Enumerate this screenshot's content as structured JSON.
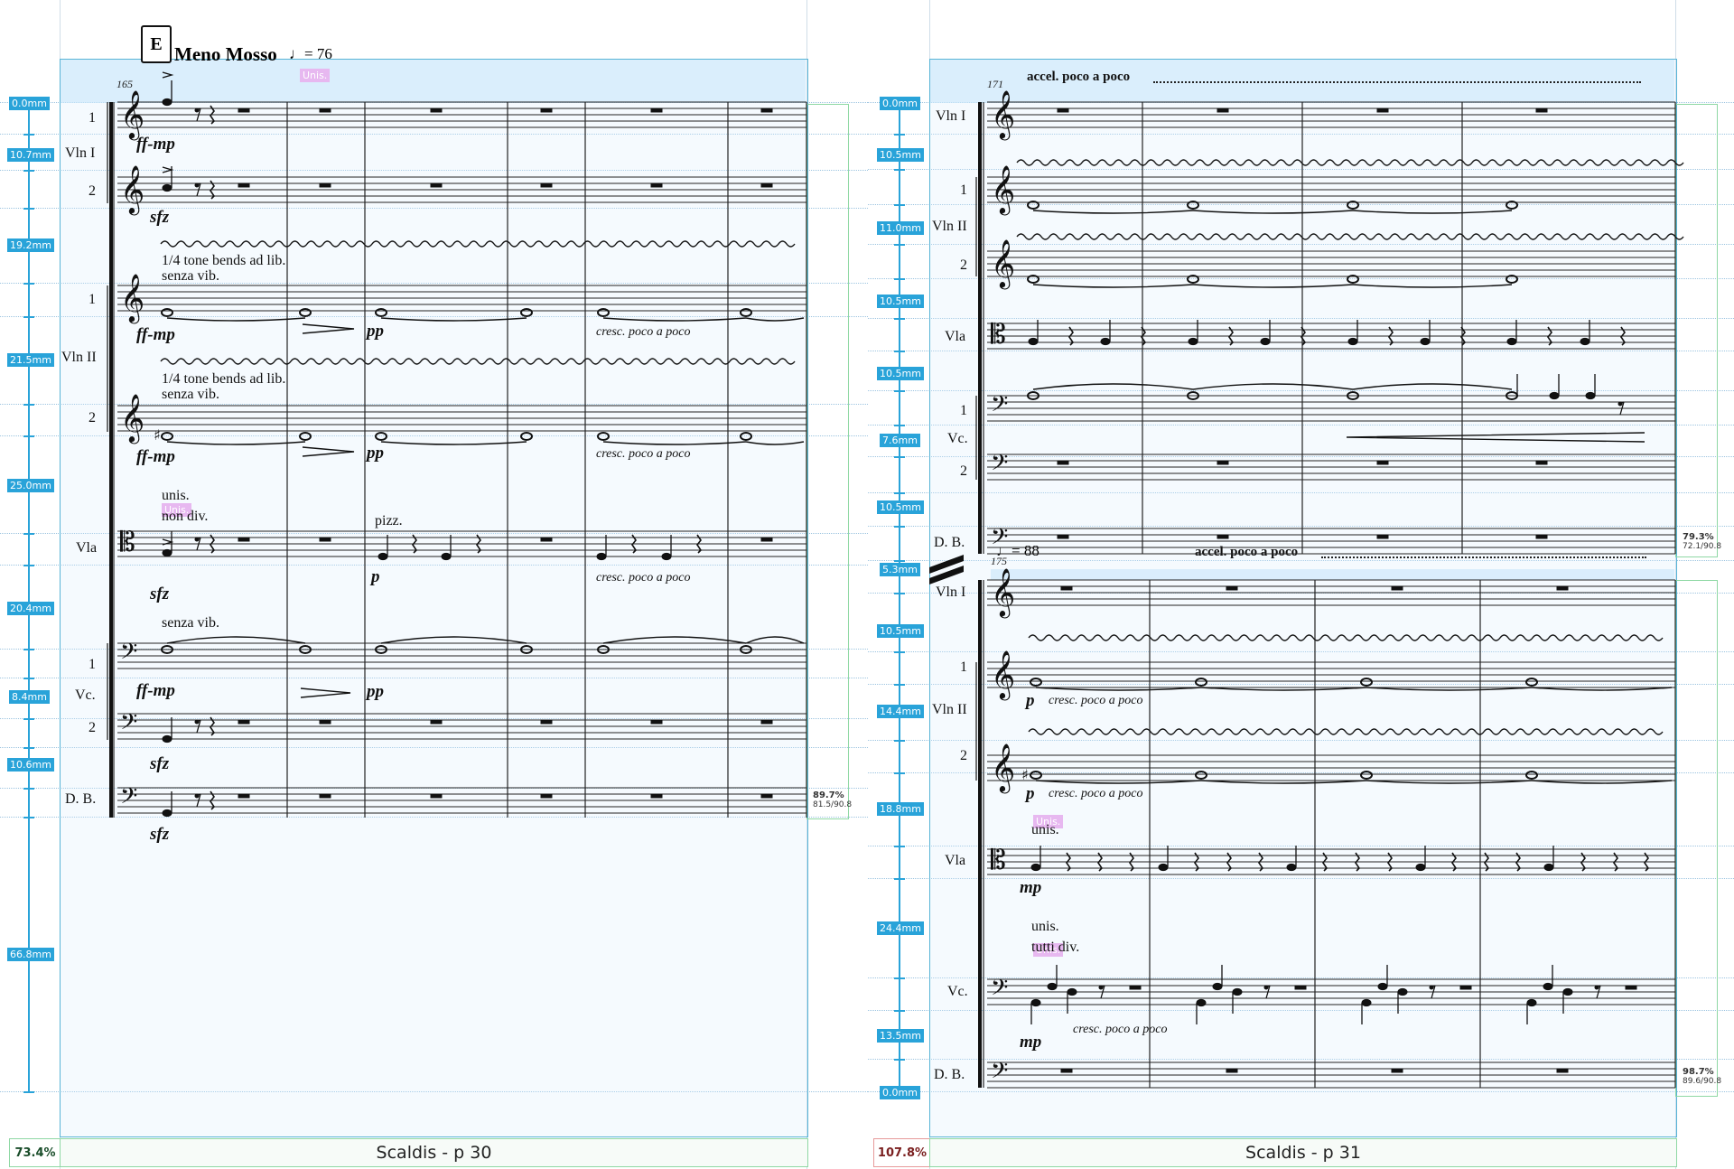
{
  "pages": {
    "left": {
      "footer": "Scaldis - p 30",
      "fill_pct": "73.4%",
      "system_fill_pct": "89.7%",
      "system_fill_ratio": "81.5/90.8",
      "rehearsal_mark": "E",
      "tempo_text": "Meno Mosso",
      "tempo_value": "= 76",
      "measure_number": "165",
      "tags": [
        "Unis.",
        "Unis."
      ],
      "spacing": [
        "0.0mm",
        "10.7mm",
        "19.2mm",
        "21.5mm",
        "25.0mm",
        "20.4mm",
        "8.4mm",
        "10.6mm",
        "66.8mm"
      ],
      "staff_labels": {
        "vln1_1": "1",
        "vln1": "Vln I",
        "vln1_2": "2",
        "vln2_1": "1",
        "vln2": "Vln II",
        "vln2_2": "2",
        "vla": "Vla",
        "vc1": "1",
        "vc": "Vc.",
        "vc2": "2",
        "db": "D. B."
      },
      "texts": {
        "bends1": "1/4 tone bends ad lib.",
        "senza1": "senza vib.",
        "bends2": "1/4 tone bends ad lib.",
        "senza2": "senza vib.",
        "unis": "unis.",
        "nondiv": "non div.",
        "pizz": "pizz.",
        "senza3": "senza vib.",
        "cresc1": "cresc. poco a poco",
        "cresc2": "cresc. poco a poco",
        "cresc3": "cresc. poco a poco"
      },
      "dynamics": {
        "d1": "ff-mp",
        "d2": "sfz",
        "d3": "ff-mp",
        "d4": "pp",
        "d5": "ff-mp",
        "d6": "pp",
        "d7": "sfz",
        "d8": "p",
        "d9": "ff-mp",
        "d10": "pp",
        "d11": "sfz",
        "d12": "sfz"
      }
    },
    "right": {
      "footer": "Scaldis - p 31",
      "fill_pct": "107.8%",
      "system1_fill_pct": "79.3%",
      "system1_fill_ratio": "72.1/90.8",
      "system2_fill_pct": "98.7%",
      "system2_fill_ratio": "89.6/90.8",
      "measure_number_1": "171",
      "measure_number_2": "175",
      "accel1": "accel. poco a poco",
      "accel2": "accel. poco a poco",
      "tempo_value": "= 88",
      "tags": [
        "Unis.",
        "Unis."
      ],
      "spacing1": [
        "0.0mm",
        "10.5mm",
        "11.0mm",
        "10.5mm",
        "10.5mm",
        "7.6mm",
        "10.5mm",
        "5.3mm"
      ],
      "spacing2": [
        "10.5mm",
        "14.4mm",
        "18.8mm",
        "24.4mm",
        "13.5mm",
        "0.0mm"
      ],
      "staff_labels_1": {
        "vln1": "Vln I",
        "vln2_1": "1",
        "vln2": "Vln II",
        "vln2_2": "2",
        "vla": "Vla",
        "vc1": "1",
        "vc": "Vc.",
        "vc2": "2",
        "db": "D. B."
      },
      "staff_labels_2": {
        "vln1": "Vln I",
        "vln2_1": "1",
        "vln2": "Vln II",
        "vln2_2": "2",
        "vla": "Vla",
        "vc": "Vc.",
        "db": "D. B."
      },
      "texts": {
        "cresc1": "cresc. poco a poco",
        "cresc2": "cresc. poco a poco",
        "unis1": "unis.",
        "unis2": "unis.",
        "tuttidiv": "tutti div.",
        "cresc3": "cresc. poco a poco"
      },
      "dynamics": {
        "d1": "p",
        "d2": "p",
        "d3": "mp",
        "d4": "mp"
      }
    }
  }
}
